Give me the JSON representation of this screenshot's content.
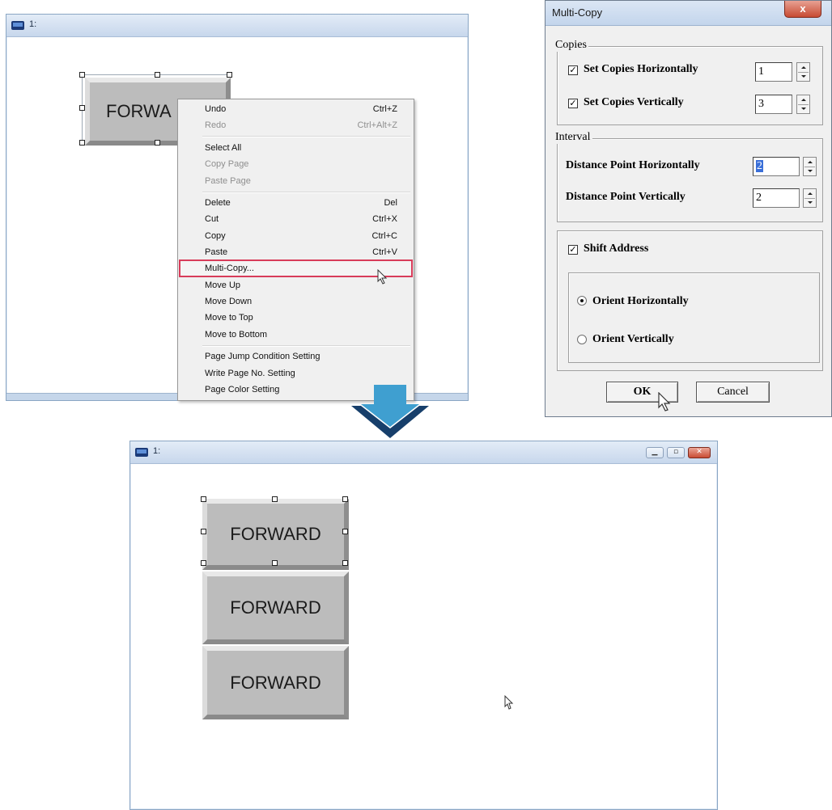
{
  "top_window": {
    "title": "1:",
    "button_text": "FORWA"
  },
  "context_menu": {
    "items": [
      {
        "label": "Undo",
        "shortcut": "Ctrl+Z"
      },
      {
        "label": "Redo",
        "shortcut": "Ctrl+Alt+Z"
      },
      {
        "label": "Select All",
        "shortcut": ""
      },
      {
        "label": "Copy Page",
        "shortcut": ""
      },
      {
        "label": "Paste Page",
        "shortcut": ""
      },
      {
        "label": "Delete",
        "shortcut": "Del"
      },
      {
        "label": "Cut",
        "shortcut": "Ctrl+X"
      },
      {
        "label": "Copy",
        "shortcut": "Ctrl+C"
      },
      {
        "label": "Paste",
        "shortcut": "Ctrl+V"
      },
      {
        "label": "Multi-Copy...",
        "shortcut": ""
      },
      {
        "label": "Move Up",
        "shortcut": ""
      },
      {
        "label": "Move Down",
        "shortcut": ""
      },
      {
        "label": "Move to Top",
        "shortcut": ""
      },
      {
        "label": "Move to Bottom",
        "shortcut": ""
      },
      {
        "label": "Page Jump Condition Setting",
        "shortcut": ""
      },
      {
        "label": "Write Page No. Setting",
        "shortcut": ""
      },
      {
        "label": "Page Color Setting",
        "shortcut": ""
      }
    ]
  },
  "dialog": {
    "title": "Multi-Copy",
    "close_label": "x",
    "copies_group": "Copies",
    "set_h_label": "Set Copies Horizontally",
    "set_h_value": "1",
    "set_v_label": "Set Copies Vertically",
    "set_v_value": "3",
    "interval_group": "Interval",
    "dist_h_label": "Distance Point Horizontally",
    "dist_h_value": "2",
    "dist_v_label": "Distance Point Vertically",
    "dist_v_value": "2",
    "shift_label": "Shift Address",
    "orient_h_label": "Orient Horizontally",
    "orient_v_label": "Orient Vertically",
    "ok_label": "OK",
    "cancel_label": "Cancel",
    "check_mark": "✓"
  },
  "bottom_window": {
    "title": "1:",
    "buttons": [
      "FORWARD",
      "FORWARD",
      "FORWARD"
    ]
  },
  "colors": {
    "arrow": "#3f9fd0",
    "highlight": "#d83c5a"
  }
}
